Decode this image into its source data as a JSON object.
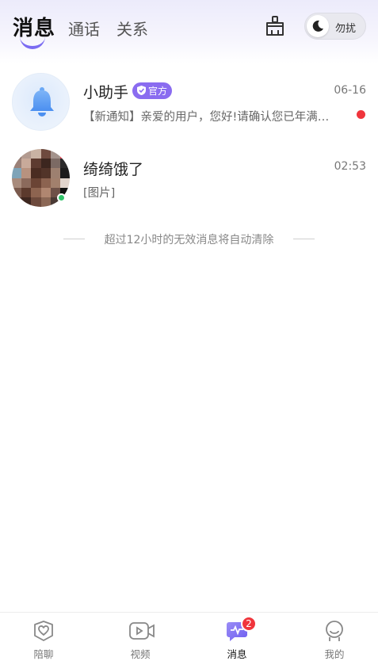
{
  "header": {
    "tabs": [
      {
        "label": "消息",
        "active": true
      },
      {
        "label": "通话",
        "active": false
      },
      {
        "label": "关系",
        "active": false
      }
    ],
    "clean_icon": "broom-icon",
    "dnd_toggle": {
      "label": "勿扰",
      "icon": "moon-icon",
      "enabled": false
    }
  },
  "conversations": [
    {
      "name": "小助手",
      "badge": "官方",
      "time": "06-16",
      "preview": "【新通知】亲爱的用户，您好!请确认您已年满…",
      "unread": true,
      "avatar": "bell-icon"
    },
    {
      "name": "绮绮饿了",
      "time": "02:53",
      "preview": "[图片]",
      "online": true,
      "avatar": "user-photo"
    }
  ],
  "notice": "超过12小时的无效消息将自动清除",
  "tabbar": {
    "items": [
      {
        "label": "陪聊",
        "icon": "heart-shield-icon",
        "active": false
      },
      {
        "label": "视频",
        "icon": "video-icon",
        "active": false
      },
      {
        "label": "消息",
        "icon": "message-icon",
        "active": true,
        "badge": "2"
      },
      {
        "label": "我的",
        "icon": "profile-icon",
        "active": false
      }
    ]
  },
  "colors": {
    "accent": "#7b6cf2",
    "badge": "#8a6cf0",
    "unread": "#f0353c",
    "online": "#30c46a"
  }
}
